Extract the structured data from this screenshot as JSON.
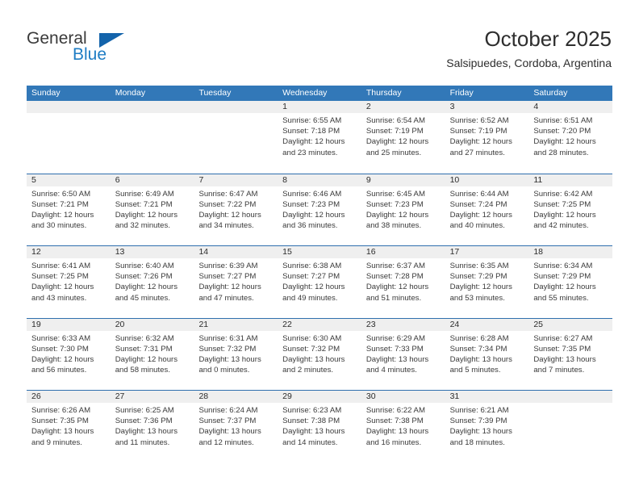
{
  "brand": {
    "name_part1": "General",
    "name_part2": "Blue",
    "colors": {
      "general": "#3a3a3a",
      "blue": "#1f7dc4",
      "triangle": "#1464ab"
    }
  },
  "header": {
    "month_title": "October 2025",
    "location": "Salsipuedes, Cordoba, Argentina"
  },
  "theme": {
    "header_bar": "#3278b8",
    "row_divider": "#2f6fae",
    "day_band": "#efefef",
    "text": "#3a3a3a"
  },
  "weekdays": [
    {
      "label": "Sunday"
    },
    {
      "label": "Monday"
    },
    {
      "label": "Tuesday"
    },
    {
      "label": "Wednesday"
    },
    {
      "label": "Thursday"
    },
    {
      "label": "Friday"
    },
    {
      "label": "Saturday"
    }
  ],
  "weeks": [
    [
      {
        "day": "",
        "empty": true
      },
      {
        "day": "",
        "empty": true
      },
      {
        "day": "",
        "empty": true
      },
      {
        "day": "1",
        "sunrise": "Sunrise: 6:55 AM",
        "sunset": "Sunset: 7:18 PM",
        "daylight_line1": "Daylight: 12 hours",
        "daylight_line2": "and 23 minutes."
      },
      {
        "day": "2",
        "sunrise": "Sunrise: 6:54 AM",
        "sunset": "Sunset: 7:19 PM",
        "daylight_line1": "Daylight: 12 hours",
        "daylight_line2": "and 25 minutes."
      },
      {
        "day": "3",
        "sunrise": "Sunrise: 6:52 AM",
        "sunset": "Sunset: 7:19 PM",
        "daylight_line1": "Daylight: 12 hours",
        "daylight_line2": "and 27 minutes."
      },
      {
        "day": "4",
        "sunrise": "Sunrise: 6:51 AM",
        "sunset": "Sunset: 7:20 PM",
        "daylight_line1": "Daylight: 12 hours",
        "daylight_line2": "and 28 minutes."
      }
    ],
    [
      {
        "day": "5",
        "sunrise": "Sunrise: 6:50 AM",
        "sunset": "Sunset: 7:21 PM",
        "daylight_line1": "Daylight: 12 hours",
        "daylight_line2": "and 30 minutes."
      },
      {
        "day": "6",
        "sunrise": "Sunrise: 6:49 AM",
        "sunset": "Sunset: 7:21 PM",
        "daylight_line1": "Daylight: 12 hours",
        "daylight_line2": "and 32 minutes."
      },
      {
        "day": "7",
        "sunrise": "Sunrise: 6:47 AM",
        "sunset": "Sunset: 7:22 PM",
        "daylight_line1": "Daylight: 12 hours",
        "daylight_line2": "and 34 minutes."
      },
      {
        "day": "8",
        "sunrise": "Sunrise: 6:46 AM",
        "sunset": "Sunset: 7:23 PM",
        "daylight_line1": "Daylight: 12 hours",
        "daylight_line2": "and 36 minutes."
      },
      {
        "day": "9",
        "sunrise": "Sunrise: 6:45 AM",
        "sunset": "Sunset: 7:23 PM",
        "daylight_line1": "Daylight: 12 hours",
        "daylight_line2": "and 38 minutes."
      },
      {
        "day": "10",
        "sunrise": "Sunrise: 6:44 AM",
        "sunset": "Sunset: 7:24 PM",
        "daylight_line1": "Daylight: 12 hours",
        "daylight_line2": "and 40 minutes."
      },
      {
        "day": "11",
        "sunrise": "Sunrise: 6:42 AM",
        "sunset": "Sunset: 7:25 PM",
        "daylight_line1": "Daylight: 12 hours",
        "daylight_line2": "and 42 minutes."
      }
    ],
    [
      {
        "day": "12",
        "sunrise": "Sunrise: 6:41 AM",
        "sunset": "Sunset: 7:25 PM",
        "daylight_line1": "Daylight: 12 hours",
        "daylight_line2": "and 43 minutes."
      },
      {
        "day": "13",
        "sunrise": "Sunrise: 6:40 AM",
        "sunset": "Sunset: 7:26 PM",
        "daylight_line1": "Daylight: 12 hours",
        "daylight_line2": "and 45 minutes."
      },
      {
        "day": "14",
        "sunrise": "Sunrise: 6:39 AM",
        "sunset": "Sunset: 7:27 PM",
        "daylight_line1": "Daylight: 12 hours",
        "daylight_line2": "and 47 minutes."
      },
      {
        "day": "15",
        "sunrise": "Sunrise: 6:38 AM",
        "sunset": "Sunset: 7:27 PM",
        "daylight_line1": "Daylight: 12 hours",
        "daylight_line2": "and 49 minutes."
      },
      {
        "day": "16",
        "sunrise": "Sunrise: 6:37 AM",
        "sunset": "Sunset: 7:28 PM",
        "daylight_line1": "Daylight: 12 hours",
        "daylight_line2": "and 51 minutes."
      },
      {
        "day": "17",
        "sunrise": "Sunrise: 6:35 AM",
        "sunset": "Sunset: 7:29 PM",
        "daylight_line1": "Daylight: 12 hours",
        "daylight_line2": "and 53 minutes."
      },
      {
        "day": "18",
        "sunrise": "Sunrise: 6:34 AM",
        "sunset": "Sunset: 7:29 PM",
        "daylight_line1": "Daylight: 12 hours",
        "daylight_line2": "and 55 minutes."
      }
    ],
    [
      {
        "day": "19",
        "sunrise": "Sunrise: 6:33 AM",
        "sunset": "Sunset: 7:30 PM",
        "daylight_line1": "Daylight: 12 hours",
        "daylight_line2": "and 56 minutes."
      },
      {
        "day": "20",
        "sunrise": "Sunrise: 6:32 AM",
        "sunset": "Sunset: 7:31 PM",
        "daylight_line1": "Daylight: 12 hours",
        "daylight_line2": "and 58 minutes."
      },
      {
        "day": "21",
        "sunrise": "Sunrise: 6:31 AM",
        "sunset": "Sunset: 7:32 PM",
        "daylight_line1": "Daylight: 13 hours",
        "daylight_line2": "and 0 minutes."
      },
      {
        "day": "22",
        "sunrise": "Sunrise: 6:30 AM",
        "sunset": "Sunset: 7:32 PM",
        "daylight_line1": "Daylight: 13 hours",
        "daylight_line2": "and 2 minutes."
      },
      {
        "day": "23",
        "sunrise": "Sunrise: 6:29 AM",
        "sunset": "Sunset: 7:33 PM",
        "daylight_line1": "Daylight: 13 hours",
        "daylight_line2": "and 4 minutes."
      },
      {
        "day": "24",
        "sunrise": "Sunrise: 6:28 AM",
        "sunset": "Sunset: 7:34 PM",
        "daylight_line1": "Daylight: 13 hours",
        "daylight_line2": "and 5 minutes."
      },
      {
        "day": "25",
        "sunrise": "Sunrise: 6:27 AM",
        "sunset": "Sunset: 7:35 PM",
        "daylight_line1": "Daylight: 13 hours",
        "daylight_line2": "and 7 minutes."
      }
    ],
    [
      {
        "day": "26",
        "sunrise": "Sunrise: 6:26 AM",
        "sunset": "Sunset: 7:35 PM",
        "daylight_line1": "Daylight: 13 hours",
        "daylight_line2": "and 9 minutes."
      },
      {
        "day": "27",
        "sunrise": "Sunrise: 6:25 AM",
        "sunset": "Sunset: 7:36 PM",
        "daylight_line1": "Daylight: 13 hours",
        "daylight_line2": "and 11 minutes."
      },
      {
        "day": "28",
        "sunrise": "Sunrise: 6:24 AM",
        "sunset": "Sunset: 7:37 PM",
        "daylight_line1": "Daylight: 13 hours",
        "daylight_line2": "and 12 minutes."
      },
      {
        "day": "29",
        "sunrise": "Sunrise: 6:23 AM",
        "sunset": "Sunset: 7:38 PM",
        "daylight_line1": "Daylight: 13 hours",
        "daylight_line2": "and 14 minutes."
      },
      {
        "day": "30",
        "sunrise": "Sunrise: 6:22 AM",
        "sunset": "Sunset: 7:38 PM",
        "daylight_line1": "Daylight: 13 hours",
        "daylight_line2": "and 16 minutes."
      },
      {
        "day": "31",
        "sunrise": "Sunrise: 6:21 AM",
        "sunset": "Sunset: 7:39 PM",
        "daylight_line1": "Daylight: 13 hours",
        "daylight_line2": "and 18 minutes."
      },
      {
        "day": "",
        "empty": true
      }
    ]
  ]
}
